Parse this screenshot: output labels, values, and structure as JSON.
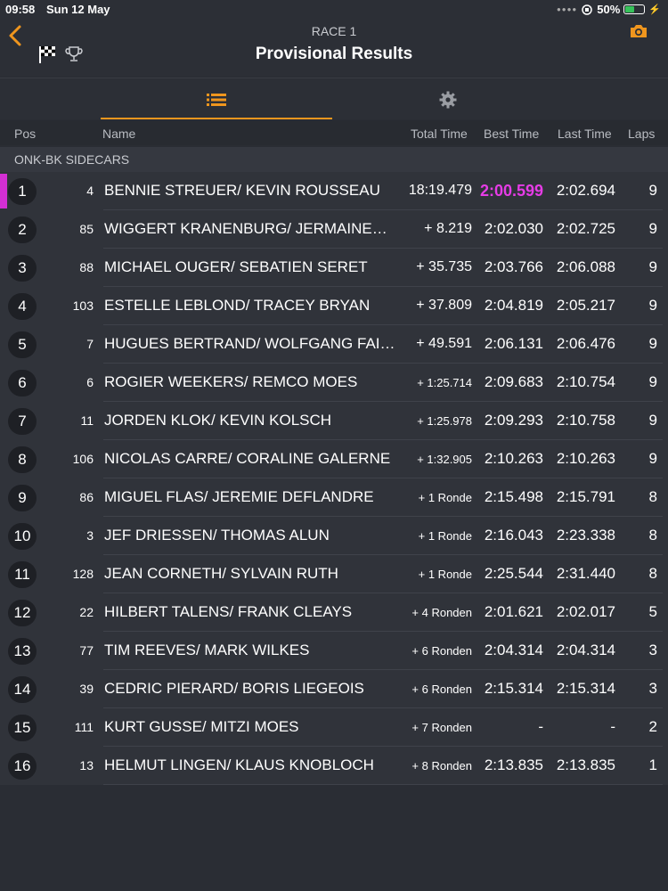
{
  "status_bar": {
    "time": "09:58",
    "date": "Sun 12 May",
    "battery": "50%"
  },
  "header": {
    "race_label": "RACE 1",
    "title": "Provisional Results"
  },
  "columns": {
    "pos": "Pos",
    "name": "Name",
    "total": "Total Time",
    "best": "Best Time",
    "last": "Last Time",
    "laps": "Laps"
  },
  "group": "ONK-BK SIDECARS",
  "colors": {
    "accent": "#f0961e",
    "fastest": "#e63ce6",
    "leader_mark": "#d32fd3"
  },
  "rows": [
    {
      "pos": "1",
      "num": "4",
      "name": "BENNIE STREUER/ KEVIN ROUSSEAU",
      "total": "18:19.479",
      "best": "2:00.599",
      "last": "2:02.694",
      "laps": "9"
    },
    {
      "pos": "2",
      "num": "85",
      "name": "WIGGERT KRANENBURG/ JERMAINE…",
      "total": "+ 8.219",
      "best": "2:02.030",
      "last": "2:02.725",
      "laps": "9"
    },
    {
      "pos": "3",
      "num": "88",
      "name": "MICHAEL OUGER/ SEBATIEN SERET",
      "total": "+ 35.735",
      "best": "2:03.766",
      "last": "2:06.088",
      "laps": "9"
    },
    {
      "pos": "4",
      "num": "103",
      "name": "ESTELLE LEBLOND/ TRACEY BRYAN",
      "total": "+ 37.809",
      "best": "2:04.819",
      "last": "2:05.217",
      "laps": "9"
    },
    {
      "pos": "5",
      "num": "7",
      "name": "HUGUES BERTRAND/ WOLFGANG FAI…",
      "total": "+ 49.591",
      "best": "2:06.131",
      "last": "2:06.476",
      "laps": "9"
    },
    {
      "pos": "6",
      "num": "6",
      "name": "ROGIER WEEKERS/ REMCO MOES",
      "total": "+ 1:25.714",
      "best": "2:09.683",
      "last": "2:10.754",
      "laps": "9"
    },
    {
      "pos": "7",
      "num": "11",
      "name": "JORDEN KLOK/ KEVIN KOLSCH",
      "total": "+ 1:25.978",
      "best": "2:09.293",
      "last": "2:10.758",
      "laps": "9"
    },
    {
      "pos": "8",
      "num": "106",
      "name": "NICOLAS CARRE/ CORALINE GALERNE",
      "total": "+ 1:32.905",
      "best": "2:10.263",
      "last": "2:10.263",
      "laps": "9"
    },
    {
      "pos": "9",
      "num": "86",
      "name": "MIGUEL FLAS/ JEREMIE DEFLANDRE",
      "total": "+ 1 Ronde",
      "best": "2:15.498",
      "last": "2:15.791",
      "laps": "8"
    },
    {
      "pos": "10",
      "num": "3",
      "name": "JEF DRIESSEN/ THOMAS ALUN",
      "total": "+ 1 Ronde",
      "best": "2:16.043",
      "last": "2:23.338",
      "laps": "8"
    },
    {
      "pos": "11",
      "num": "128",
      "name": "JEAN CORNETH/ SYLVAIN RUTH",
      "total": "+ 1 Ronde",
      "best": "2:25.544",
      "last": "2:31.440",
      "laps": "8"
    },
    {
      "pos": "12",
      "num": "22",
      "name": "HILBERT TALENS/ FRANK CLEAYS",
      "total": "+ 4 Ronden",
      "best": "2:01.621",
      "last": "2:02.017",
      "laps": "5"
    },
    {
      "pos": "13",
      "num": "77",
      "name": "TIM REEVES/ MARK WILKES",
      "total": "+ 6 Ronden",
      "best": "2:04.314",
      "last": "2:04.314",
      "laps": "3"
    },
    {
      "pos": "14",
      "num": "39",
      "name": "CEDRIC PIERARD/ BORIS LIEGEOIS",
      "total": "+ 6 Ronden",
      "best": "2:15.314",
      "last": "2:15.314",
      "laps": "3"
    },
    {
      "pos": "15",
      "num": "111",
      "name": "KURT GUSSE/ MITZI MOES",
      "total": "+ 7 Ronden",
      "best": "-",
      "last": "-",
      "laps": "2"
    },
    {
      "pos": "16",
      "num": "13",
      "name": "HELMUT LINGEN/ KLAUS KNOBLOCH",
      "total": "+ 8 Ronden",
      "best": "2:13.835",
      "last": "2:13.835",
      "laps": "1"
    }
  ]
}
